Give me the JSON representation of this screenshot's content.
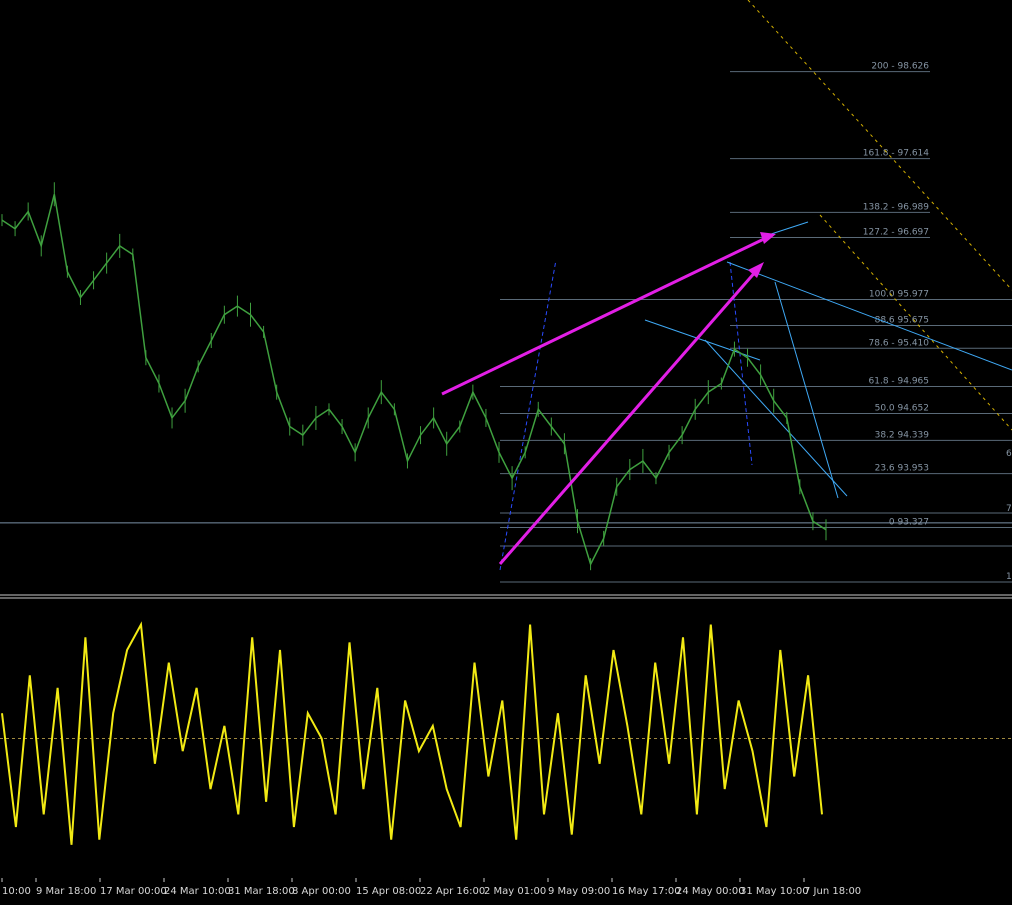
{
  "chart_data": {
    "type": "line",
    "main_panel": {
      "series_style": "bar",
      "y_range": [
        92.6,
        99.4
      ],
      "horizontal_level": 93.38,
      "close": [
        96.9,
        96.8,
        97.0,
        96.6,
        97.2,
        96.3,
        96.0,
        96.2,
        96.4,
        96.6,
        96.5,
        95.3,
        95.0,
        94.6,
        94.8,
        95.2,
        95.5,
        95.8,
        95.9,
        95.8,
        95.6,
        94.9,
        94.5,
        94.4,
        94.6,
        94.7,
        94.5,
        94.2,
        94.6,
        94.9,
        94.7,
        94.1,
        94.4,
        94.6,
        94.3,
        94.5,
        94.9,
        94.6,
        94.2,
        93.9,
        94.2,
        94.7,
        94.5,
        94.3,
        93.4,
        92.9,
        93.2,
        93.8,
        94.0,
        94.1,
        93.9,
        94.2,
        94.4,
        94.7,
        94.9,
        95.0,
        95.4,
        95.3,
        95.1,
        94.8,
        94.6,
        93.8,
        93.4,
        93.3
      ],
      "fibonacci_levels": [
        {
          "label": "200 - 98.626",
          "value": 98.626
        },
        {
          "label": "161.8 - 97.614",
          "value": 97.614
        },
        {
          "label": "138.2 - 96.989",
          "value": 96.989
        },
        {
          "label": "127.2 - 96.697",
          "value": 96.697
        },
        {
          "label": "100.0 95.977",
          "value": 95.977
        },
        {
          "label": "88.6 95.675",
          "value": 95.675
        },
        {
          "label": "78.6 - 95.410",
          "value": 95.41
        },
        {
          "label": "61.8 - 94.965",
          "value": 94.965
        },
        {
          "label": "50.0 94.652",
          "value": 94.652
        },
        {
          "label": "38.2 94.339",
          "value": 94.339
        },
        {
          "label": "23.6 93.953",
          "value": 93.953
        },
        {
          "label": "0 93.327",
          "value": 93.327
        }
      ],
      "right_edge_labels": [
        "6",
        "7",
        "1"
      ]
    },
    "oscillator_panel": {
      "series_style": "line",
      "y_range": [
        0,
        100
      ],
      "mid_level": 50,
      "values": [
        60,
        15,
        75,
        20,
        70,
        8,
        90,
        10,
        60,
        85,
        95,
        40,
        80,
        45,
        70,
        30,
        55,
        20,
        90,
        25,
        85,
        15,
        60,
        50,
        20,
        88,
        30,
        70,
        10,
        65,
        45,
        55,
        30,
        15,
        80,
        35,
        65,
        10,
        95,
        20,
        60,
        12,
        75,
        40,
        85,
        55,
        20,
        80,
        40,
        90,
        20,
        95,
        30,
        65,
        45,
        15,
        85,
        35,
        75,
        20
      ]
    },
    "x_tick_labels": [
      "10:00",
      "9 Mar 18:00",
      "17 Mar 00:00",
      "24 Mar 10:00",
      "31 Mar 18:00",
      "8 Apr 00:00",
      "15 Apr 08:00",
      "22 Apr 16:00",
      "2 May 01:00",
      "9 May 09:00",
      "16 May 17:00",
      "24 May 00:00",
      "31 May 10:00",
      "7 Jun 18:00"
    ]
  }
}
